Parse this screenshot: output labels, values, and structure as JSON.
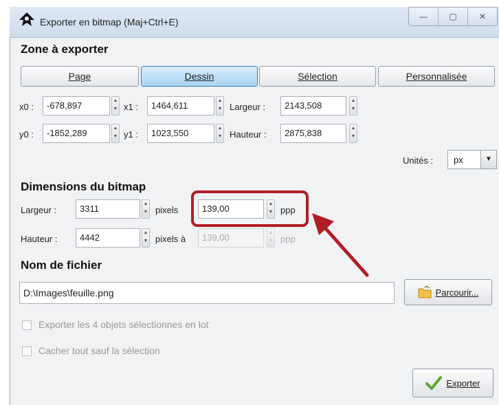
{
  "window": {
    "title": "Exporter en bitmap (Maj+Ctrl+E)",
    "controls": {
      "minimize": "—",
      "maximize": "▢",
      "close": "✕"
    }
  },
  "zone": {
    "title": "Zone à exporter",
    "buttons": [
      {
        "label": "Page",
        "active": false
      },
      {
        "label": "Dessin",
        "active": true
      },
      {
        "label": "Sélection",
        "active": false
      },
      {
        "label": "Personnalisée",
        "active": false
      }
    ],
    "x0": {
      "label": "x0 :",
      "value": "-678,897"
    },
    "x1": {
      "label": "x1 :",
      "value": "1464,611"
    },
    "largeur": {
      "label": "Largeur :",
      "value": "2143,508"
    },
    "y0": {
      "label": "y0 :",
      "value": "-1852,289"
    },
    "y1": {
      "label": "y1 :",
      "value": "1023,550"
    },
    "hauteur": {
      "label": "Hauteur :",
      "value": "2875,838"
    },
    "units_label": "Unités :",
    "units_value": "px"
  },
  "bitmap": {
    "title": "Dimensions du bitmap",
    "width_label": "Largeur :",
    "width_value": "3311",
    "pixels_label": "pixels",
    "dpi_value": "139,00",
    "dpi_unit": "ppp",
    "height_label": "Hauteur :",
    "height_value": "4442",
    "pixels_at_label": "pixels à",
    "dpi2_value": "139,00",
    "dpi2_unit": "ppp"
  },
  "file": {
    "title": "Nom de fichier",
    "path": "D:\\Images\\feuille.png",
    "browse_label": "Parcourir..."
  },
  "options": {
    "batch_label": "Exporter les 4 objets sélectionnes en lot",
    "hide_label": "Cacher tout sauf la sélection"
  },
  "export_label": "Exporter",
  "colors": {
    "annotation": "#b01e23",
    "active_button": "#a9d5f5"
  }
}
